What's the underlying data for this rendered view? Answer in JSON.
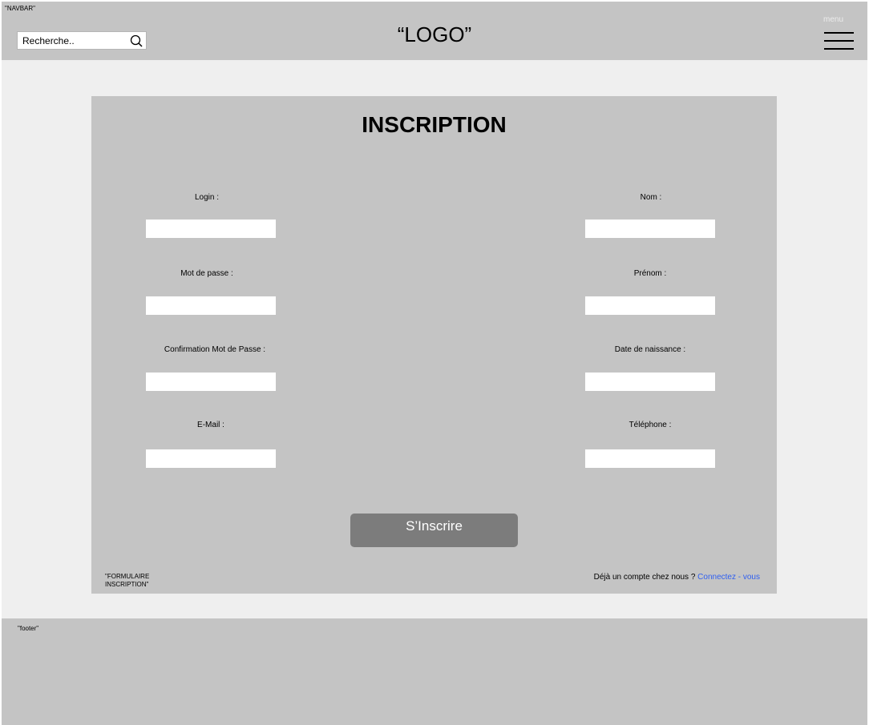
{
  "navbar": {
    "tag": "\"NAVBAR\"",
    "search": {
      "placeholder": "Recherche..",
      "icon": "search-icon"
    },
    "logo": "“LOGO”",
    "menu_label": "menu",
    "menu_icon": "hamburger-icon"
  },
  "form": {
    "title": "INSCRIPTION",
    "left_fields": [
      {
        "label": "Login :",
        "value": ""
      },
      {
        "label": "Mot de passe :",
        "value": ""
      },
      {
        "label": "Confirmation Mot de Passe :",
        "value": ""
      },
      {
        "label": "E-Mail :",
        "value": ""
      }
    ],
    "right_fields": [
      {
        "label": "Nom :",
        "value": ""
      },
      {
        "label": "Prénom :",
        "value": ""
      },
      {
        "label": "Date de naissance :",
        "value": ""
      },
      {
        "label": "Téléphone :",
        "value": ""
      }
    ],
    "submit_label": "S’Inscrire",
    "tag_line1": "\"FORMULAIRE",
    "tag_line2": "INSCRIPTION\"",
    "login_prompt": "Déjà un compte chez nous ?",
    "login_link": "Connectez - vous"
  },
  "footer": {
    "tag": "\"footer\""
  },
  "colors": {
    "panel": "#c4c4c4",
    "background": "#efefef",
    "button": "#7c7c7c",
    "link": "#2f5ff0"
  }
}
